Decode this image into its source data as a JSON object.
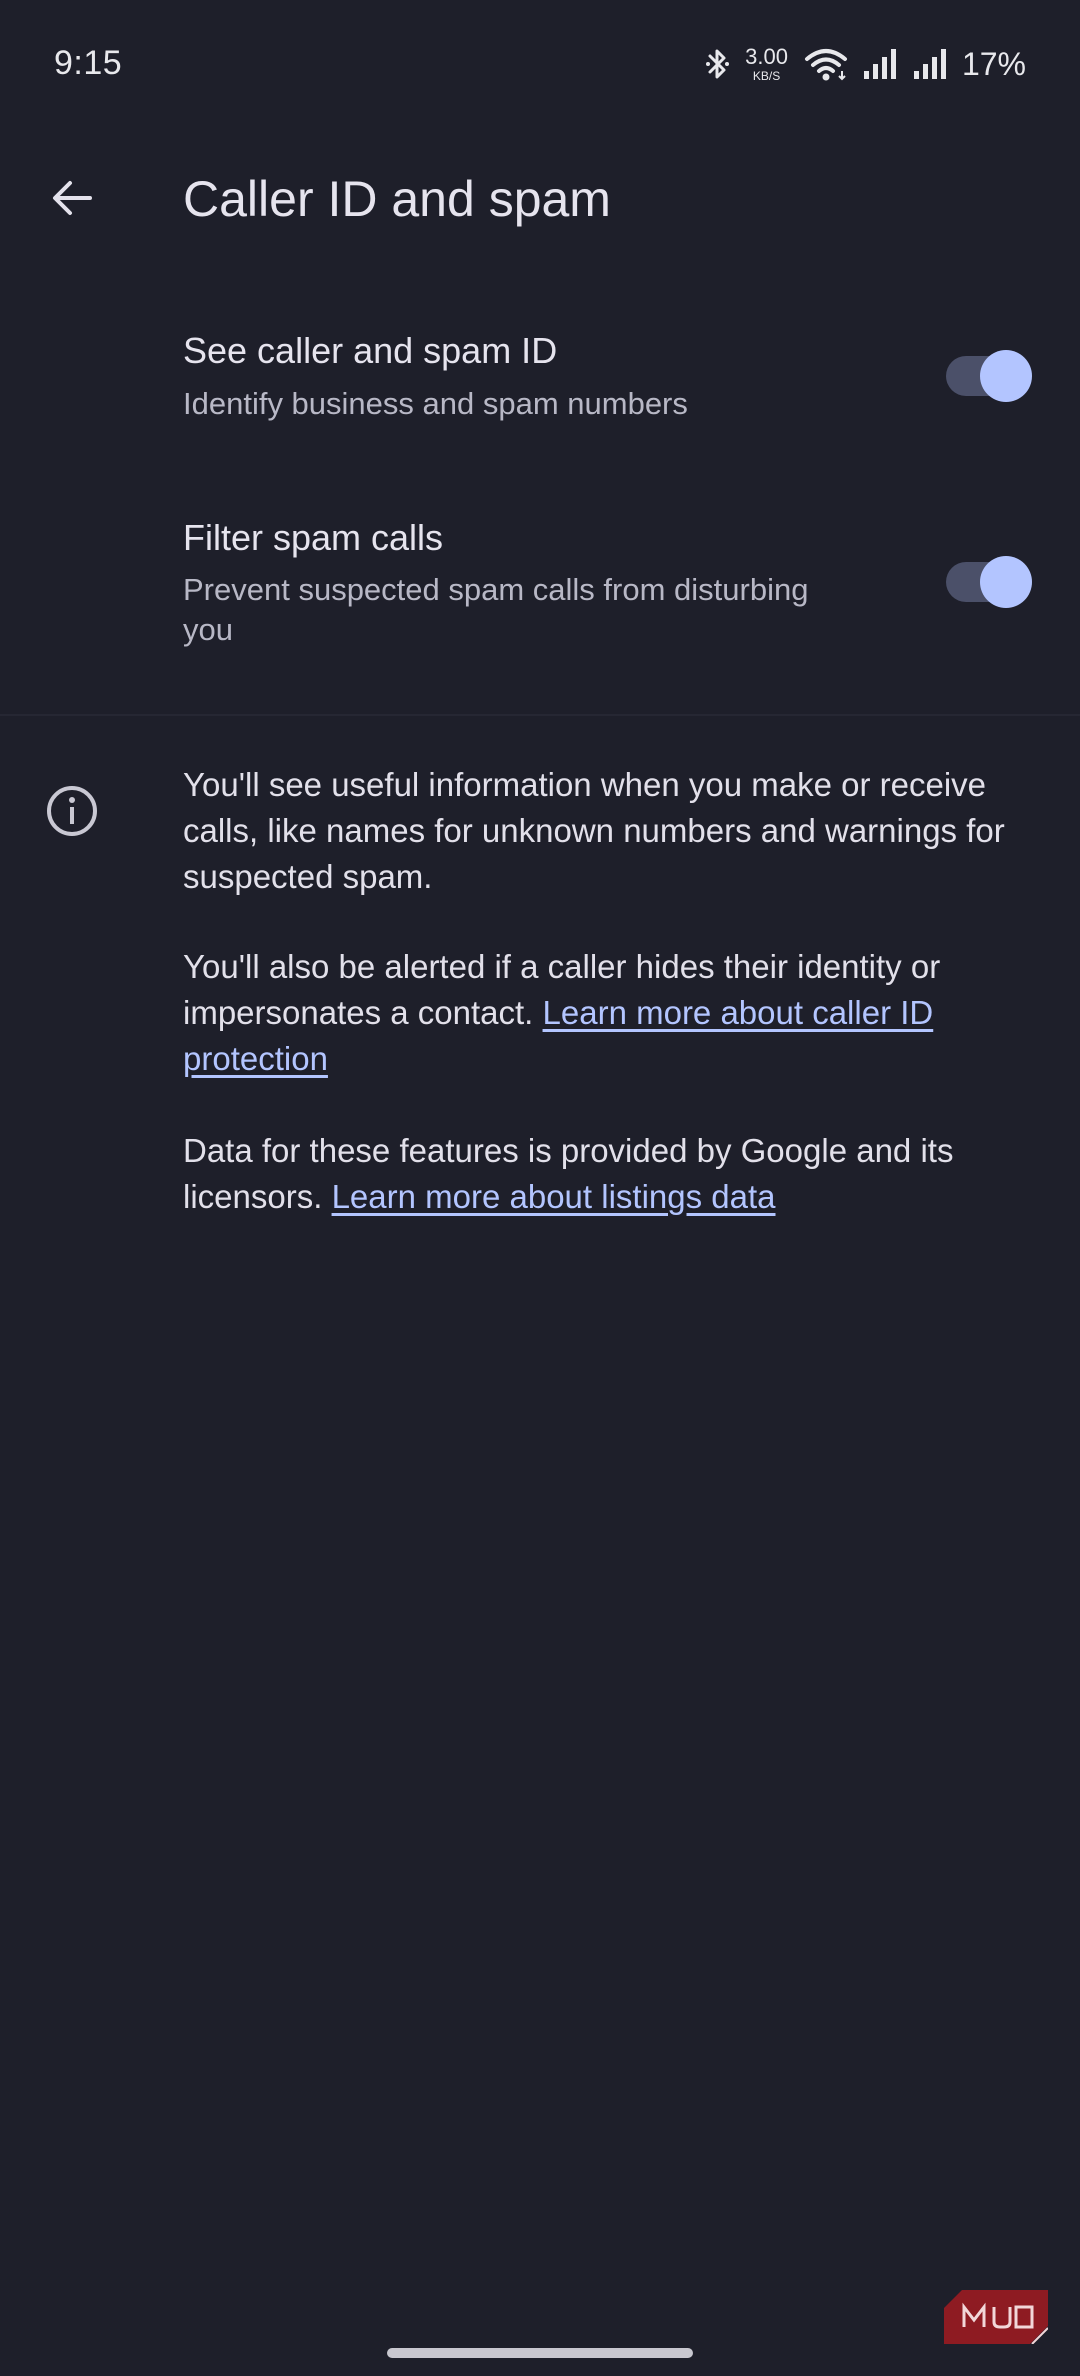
{
  "status_bar": {
    "time": "9:15",
    "net_speed_value": "3.00",
    "net_speed_unit": "KB/S",
    "battery": "17%",
    "icons": [
      "bluetooth-icon",
      "wifi-icon",
      "signal-icon",
      "signal-icon",
      "battery-icon"
    ]
  },
  "app_bar": {
    "back_icon": "arrow-back-icon",
    "title": "Caller ID and spam"
  },
  "settings": [
    {
      "title": "See caller and spam ID",
      "summary": "Identify business and spam numbers",
      "enabled": true
    },
    {
      "title": "Filter spam calls",
      "summary": "Prevent suspected spam calls from disturbing you",
      "enabled": true
    }
  ],
  "info": {
    "icon": "info-icon",
    "paragraph1": "You'll see useful information when you make or receive calls, like names for unknown numbers and warnings for suspected spam.",
    "paragraph2_text": "You'll also be alerted if a caller hides their identity or impersonates a contact.",
    "paragraph2_link": "Learn more about caller ID protection",
    "paragraph3_text": "Data for these features is provided by Google and its licensors.",
    "paragraph3_link": "Learn more about listings data"
  },
  "watermark": "MUO",
  "colors": {
    "background": "#1e1f2a",
    "accent": "#b3c5ff",
    "toggle_track": "#4b5069"
  }
}
